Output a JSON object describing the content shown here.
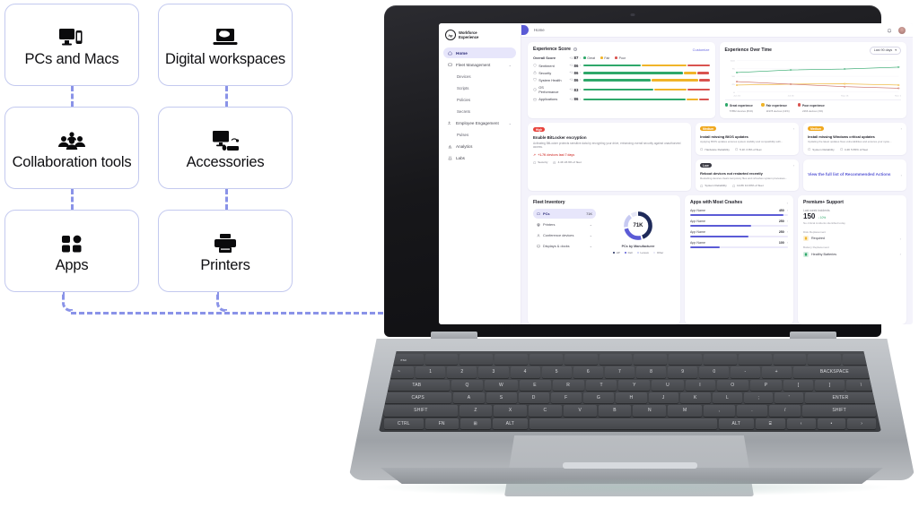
{
  "diagram": {
    "cards": [
      {
        "label": "PCs and Macs",
        "icon": "monitor-phone-icon"
      },
      {
        "label": "Digital workspaces",
        "icon": "laptop-cloud-icon"
      },
      {
        "label": "Collaboration tools",
        "icon": "people-group-icon"
      },
      {
        "label": "Accessories",
        "icon": "monitor-keyboard-mouse-icon"
      },
      {
        "label": "Apps",
        "icon": "four-squares-icon"
      },
      {
        "label": "Printers",
        "icon": "printer-icon"
      }
    ],
    "connector_color": "#8a93e8"
  },
  "dashboard": {
    "brand": {
      "line1": "Workforce",
      "line2": "Experience",
      "logo": "hp-logo"
    },
    "topbar": {
      "breadcrumb": "Home",
      "bell": "notification-bell-icon",
      "avatar": "user-avatar"
    },
    "sidebar": [
      {
        "label": "Home",
        "icon": "home-icon",
        "active": true,
        "sub": false,
        "caret": ""
      },
      {
        "label": "Fleet Management",
        "icon": "fleet-icon",
        "active": false,
        "sub": false,
        "caret": "⌄"
      },
      {
        "label": "Devices",
        "icon": "",
        "active": false,
        "sub": true,
        "caret": ""
      },
      {
        "label": "Scripts",
        "icon": "",
        "active": false,
        "sub": true,
        "caret": ""
      },
      {
        "label": "Policies",
        "icon": "",
        "active": false,
        "sub": true,
        "caret": ""
      },
      {
        "label": "Secrets",
        "icon": "",
        "active": false,
        "sub": true,
        "caret": ""
      },
      {
        "label": "Employee Engagement",
        "icon": "engagement-icon",
        "active": false,
        "sub": false,
        "caret": "⌄"
      },
      {
        "label": "Pulses",
        "icon": "",
        "active": false,
        "sub": true,
        "caret": ""
      },
      {
        "label": "Analytics",
        "icon": "analytics-icon",
        "active": false,
        "sub": false,
        "caret": ""
      },
      {
        "label": "Labs",
        "icon": "labs-icon",
        "active": false,
        "sub": false,
        "caret": ""
      }
    ],
    "experience_score": {
      "title": "Experience Score",
      "customize": "Customize",
      "legend": [
        {
          "label": "Great",
          "color": "#2ea86a"
        },
        {
          "label": "Fair",
          "color": "#f0b429"
        },
        {
          "label": "Poor",
          "color": "#d9534f"
        }
      ],
      "rows": [
        {
          "name": "Overall Score",
          "icon": "",
          "value": "87",
          "delta": "+1",
          "great": 0,
          "fair": 0,
          "poor": 0,
          "header": true
        },
        {
          "name": "Sentiment",
          "icon": "shield-icon",
          "value": "86",
          "delta": "+1",
          "great": 46,
          "fair": 36,
          "poor": 18
        },
        {
          "name": "Security",
          "icon": "lock-icon",
          "value": "86",
          "delta": "+1",
          "great": 80,
          "fair": 10,
          "poor": 10
        },
        {
          "name": "System Health",
          "icon": "heart-icon",
          "value": "86",
          "delta": "+1",
          "great": 54,
          "fair": 38,
          "poor": 8
        },
        {
          "name": "OS Performance",
          "icon": "os-icon",
          "value": "83",
          "delta": "+1",
          "great": 56,
          "fair": 26,
          "poor": 18
        },
        {
          "name": "Applications",
          "icon": "apps-icon",
          "value": "86",
          "delta": "+1",
          "great": 82,
          "fair": 10,
          "poor": 8
        }
      ]
    },
    "experience_over_time": {
      "title": "Experience Over Time",
      "range": "Last 90 days",
      "legend": [
        {
          "title": "Great experience",
          "sub": "57852 devices (81%)",
          "color": "#2ea86a"
        },
        {
          "title": "Fair experience",
          "sub": "11978 devices (13%)",
          "color": "#f0b429"
        },
        {
          "title": "Poor experience",
          "sub": "2266 devices (3%)",
          "color": "#d9534f"
        }
      ]
    },
    "recommended_actions": {
      "primary": {
        "badge": "High",
        "title": "Enable BitLocker encryption",
        "desc": "Activating BitLocker protects sensitive data by encrypting your drive, enhancing overall security against unauthorized access.",
        "metric": "+1.7K devices last 7 days",
        "tags": [
          "Security",
          "4.4K  23.9% of fleet"
        ]
      },
      "cards": [
        {
          "badge": "Medium",
          "badge_type": "med",
          "title": "Install missing BIOS updates",
          "desc": "Applying BIOS updates ensures system stability and compatibility with...",
          "tags": [
            "Hardware Reliability",
            "5.1K  3.8% of fleet"
          ]
        },
        {
          "badge": "Medium",
          "badge_type": "med",
          "title": "Install missing Windows critical updates",
          "desc": "Updating the latest updates fixes vulnerabilities and ensures your syste...",
          "tags": [
            "System Reliability",
            "4.2K  5.65% of fleet"
          ]
        },
        {
          "badge": "Low",
          "badge_type": "low",
          "title": "Reboot devices not restarted recently",
          "desc": "Restarting devices clears temporary files and refreshes system processes...",
          "tags": [
            "System Reliability",
            "14.8K  10.03% of fleet"
          ]
        }
      ],
      "link": "View the full list of Recommended Actions"
    },
    "fleet_inventory": {
      "title": "Fleet Inventory",
      "items": [
        {
          "label": "PCs",
          "icon": "pc-icon",
          "value": "71K",
          "active": true
        },
        {
          "label": "Printers",
          "icon": "printer-icon",
          "value": "",
          "active": false
        },
        {
          "label": "Conference devices",
          "icon": "conference-icon",
          "value": "",
          "active": false
        },
        {
          "label": "Displays & docks",
          "icon": "display-icon",
          "value": "",
          "active": false
        }
      ],
      "donut_center": "71K",
      "donut_caption": "PCs by Manufacturer",
      "donut_legend": [
        {
          "label": "HP",
          "color": "#1e2a5a",
          "pct": 46
        },
        {
          "label": "Dell",
          "color": "#5b5bd6",
          "pct": 27
        },
        {
          "label": "Lenovo",
          "color": "#c7caf2",
          "pct": 18
        },
        {
          "label": "Other",
          "color": "#e6e7f7",
          "pct": 9
        }
      ]
    },
    "apps_crashes": {
      "title": "Apps with Most Crashes",
      "items": [
        {
          "name": "App Name",
          "value": "450",
          "pct": 95
        },
        {
          "name": "App Name",
          "value": "250",
          "pct": 62
        },
        {
          "name": "App Name",
          "value": "250",
          "pct": 60
        },
        {
          "name": "App Name",
          "value": "100",
          "pct": 30
        }
      ]
    },
    "premium_support": {
      "title": "Premium+ Support",
      "incidents_label": "Last week incidents",
      "incidents_value": "150",
      "incidents_delta": "↓ 10%",
      "incidents_note": "No critical incidents identified today",
      "sections": [
        {
          "label": "Disk Replacement",
          "status": "Required",
          "color": "#f0b429",
          "icon": "disk-icon"
        },
        {
          "label": "Battery Replacement",
          "status": "Healthy Batteries",
          "color": "#2ea86a",
          "icon": "battery-icon"
        }
      ]
    }
  },
  "chart_data": {
    "type": "line",
    "title": "Experience Over Time",
    "x": [
      "Jan 16",
      "Jul 16",
      "Sep 16",
      "Nov 16"
    ],
    "ylim": [
      0,
      100
    ],
    "yticks": [
      0,
      25,
      50,
      75,
      100
    ],
    "grid": true,
    "legend_position": "bottom",
    "series": [
      {
        "name": "Great experience",
        "color": "#2ea86a",
        "values": [
          62,
          70,
          73,
          79
        ]
      },
      {
        "name": "Fair experience",
        "color": "#f0b429",
        "values": [
          22,
          25,
          26,
          22
        ]
      },
      {
        "name": "Poor experience",
        "color": "#c96a62",
        "values": [
          33,
          25,
          17,
          12
        ]
      }
    ]
  },
  "keyboard": {
    "row0": [
      "esc",
      "",
      "",
      "",
      "",
      "",
      "",
      "",
      "",
      "",
      "",
      "",
      "",
      ""
    ],
    "row1": [
      "~",
      "1",
      "2",
      "3",
      "4",
      "5",
      "6",
      "7",
      "8",
      "9",
      "0",
      "-",
      "+",
      "BACKSPACE"
    ],
    "row2": [
      "TAB",
      "Q",
      "W",
      "E",
      "R",
      "T",
      "Y",
      "U",
      "I",
      "O",
      "P",
      "[",
      "]",
      "\\"
    ],
    "row3": [
      "CAPS",
      "A",
      "S",
      "D",
      "F",
      "G",
      "H",
      "J",
      "K",
      "L",
      ";",
      "'",
      "ENTER"
    ],
    "row4": [
      "SHIFT",
      "Z",
      "X",
      "C",
      "V",
      "B",
      "N",
      "M",
      ",",
      ".",
      "/",
      "SHIFT"
    ],
    "row5": [
      "CTRL",
      "FN",
      "⊞",
      "ALT",
      "",
      "ALT",
      "⌸",
      "‹",
      "•",
      "›"
    ]
  }
}
